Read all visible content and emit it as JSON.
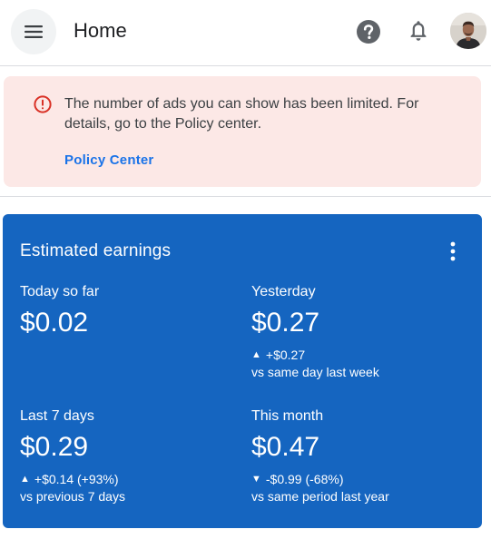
{
  "header": {
    "title": "Home",
    "icons": {
      "menu": "menu-icon",
      "help": "help-circle-icon",
      "notifications": "bell-icon",
      "avatar": "user-avatar"
    }
  },
  "alert": {
    "icon": "error-circle-icon",
    "message": "The number of ads you can show has been limited. For details, go to the Policy center.",
    "link_label": "Policy Center",
    "colors": {
      "background": "#fce8e6",
      "icon": "#d93025",
      "link": "#1a73e8"
    }
  },
  "earnings": {
    "title": "Estimated earnings",
    "menu_icon": "more-vert-icon",
    "card_color": "#1565c0",
    "metrics": [
      {
        "label": "Today so far",
        "value": "$0.02"
      },
      {
        "label": "Yesterday",
        "value": "$0.27",
        "trend": "up",
        "arrow": "▲",
        "delta": "+$0.27",
        "comparison": "vs same day last week"
      },
      {
        "label": "Last 7 days",
        "value": "$0.29",
        "trend": "up",
        "arrow": "▲",
        "delta": "+$0.14 (+93%)",
        "comparison": "vs previous 7 days"
      },
      {
        "label": "This month",
        "value": "$0.47",
        "trend": "down",
        "arrow": "▼",
        "delta": "-$0.99 (-68%)",
        "comparison": "vs same period last year"
      }
    ]
  }
}
